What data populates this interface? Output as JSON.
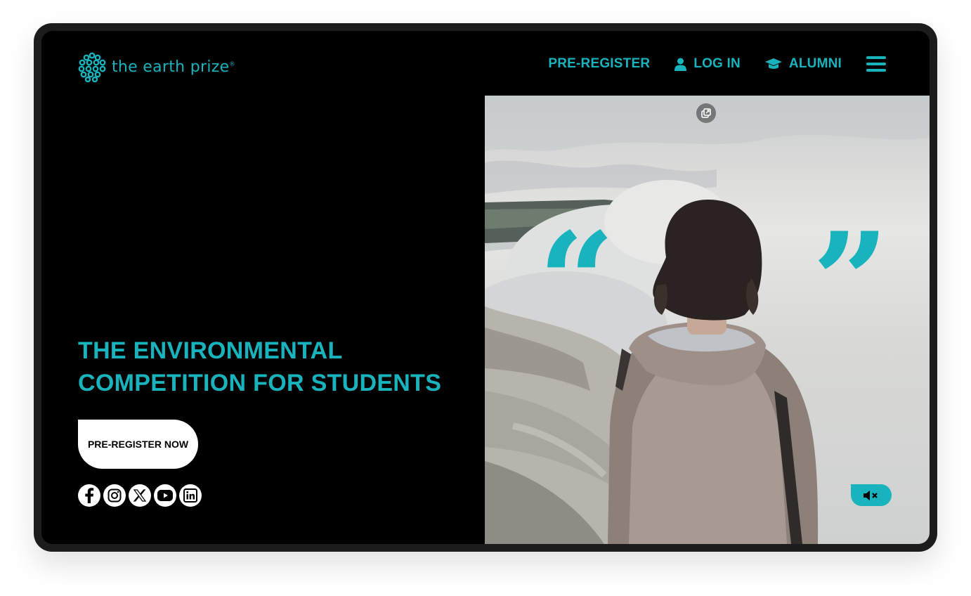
{
  "brand": {
    "logo_text": "the earth prize",
    "logo_mark": "registered",
    "accent_color": "#19b3bd"
  },
  "nav": {
    "preregister": "PRE-REGISTER",
    "login": "LOG IN",
    "alumni": "ALUMNI",
    "icons": {
      "login": "user-icon",
      "alumni": "graduation-cap-icon",
      "menu": "hamburger-menu-icon"
    }
  },
  "hero": {
    "headline_line1": "THE ENVIRONMENTAL",
    "headline_line2": "COMPETITION FOR STUDENTS",
    "cta_label": "PRE-REGISTER NOW"
  },
  "social": [
    "facebook-icon",
    "instagram-icon",
    "x-icon",
    "youtube-icon",
    "linkedin-icon"
  ],
  "video": {
    "open_quote": "“",
    "close_quote": "”",
    "controls": {
      "popout": "popout-icon",
      "mute": "mute-icon"
    }
  }
}
